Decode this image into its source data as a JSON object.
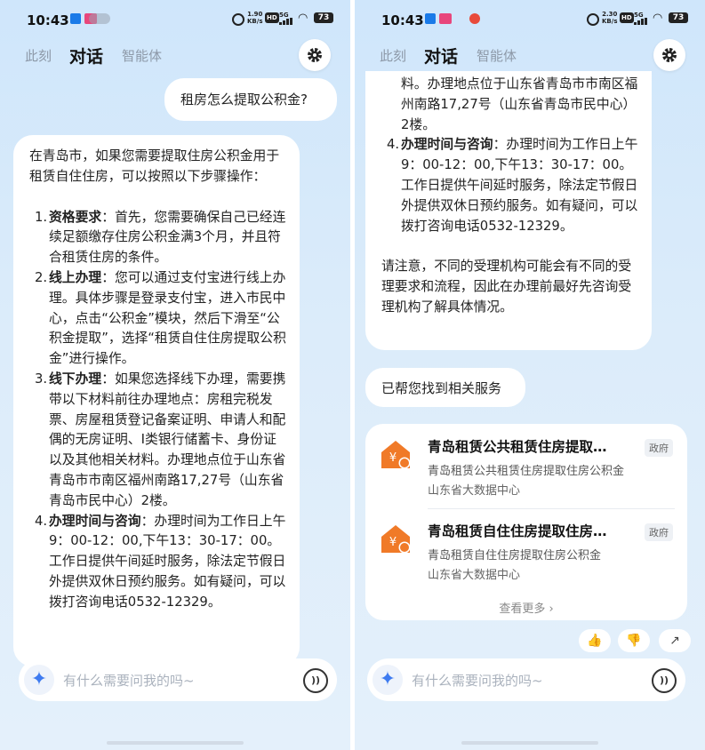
{
  "status_bar": {
    "left_time": "10:43",
    "right_time": "10:43",
    "left_speed": "1.90\nKB/s",
    "right_speed": "2.30\nKB/s",
    "hd": "HD",
    "network": "5G",
    "battery": "73"
  },
  "tabs": [
    "此刻",
    "对话",
    "智能体"
  ],
  "user_message": "租房怎么提取公积金?",
  "answer": {
    "intro": "在青岛市，如果您需要提取住房公积金用于租赁自住住房，可以按照以下步骤操作：",
    "steps": [
      {
        "num": "1.",
        "title": "资格要求",
        "text": "：首先，您需要确保自己已经连续足额缴存住房公积金满3个月，并且符合租赁住房的条件。"
      },
      {
        "num": "2.",
        "title": "线上办理",
        "text": "：您可以通过支付宝进行线上办理。具体步骤是登录支付宝，进入市民中心，点击“公积金”模块，然后下滑至“公积金提取”，选择“租赁自住住房提取公积金”进行操作。"
      },
      {
        "num": "3.",
        "title": "线下办理",
        "text": "：如果您选择线下办理，需要携带以下材料前往办理地点：房租完税发票、房屋租赁登记备案证明、申请人和配偶的无房证明、I类银行储蓄卡、身份证以及其他相关材料。办理地点位于山东省青岛市市南区福州南路17,27号（山东省青岛市民中心）2楼。"
      },
      {
        "num": "4.",
        "title": "办理时间与咨询",
        "text": "：办理时间为工作日上午9：00-12：00,下午13：30-17：00。工作日提供午间延时服务，除法定节假日外提供双休日预约服务。如有疑问，可以拨打咨询电话0532-12329。"
      }
    ],
    "cont_step3_tail": "料。办理地点位于山东省青岛市市南区福州南路17,27号（山东省青岛市民中心）2楼。",
    "note": "请注意，不同的受理机构可能会有不同的受理要求和流程，因此在办理前最好先咨询受理机构了解具体情况。"
  },
  "found_text": "已帮您找到相关服务",
  "services": [
    {
      "title": "青岛租赁公共租赁住房提取…",
      "sub1": "青岛租赁公共租赁住房提取住房公积金",
      "sub2": "山东省大数据中心",
      "tag": "政府"
    },
    {
      "title": "青岛租赁自住住房提取住房…",
      "sub1": "青岛租赁自住住房提取住房公积金",
      "sub2": "山东省大数据中心",
      "tag": "政府"
    }
  ],
  "see_more": "查看更多 ›",
  "input_placeholder": "有什么需要问我的吗~",
  "colors": {
    "accent": "#3e7bf0",
    "house_icon": "#f07a28",
    "background": "#d6e9fa"
  },
  "icons": {
    "settings": "gear-icon",
    "assistant": "sparkle-icon",
    "voice": "voice-icon",
    "thumb_up": "thumb-up-icon",
    "thumb_down": "thumb-down-icon",
    "share": "share-icon"
  }
}
